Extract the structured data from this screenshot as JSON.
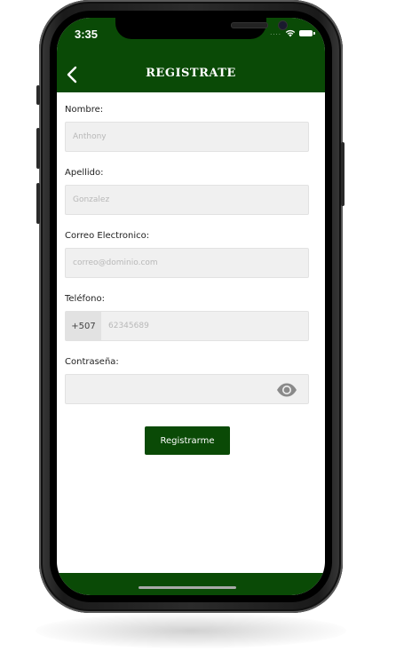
{
  "status_bar": {
    "time": "3:35",
    "signal": "...."
  },
  "header": {
    "title": "REGISTRATE"
  },
  "form": {
    "nombre": {
      "label": "Nombre:",
      "placeholder": "Anthony"
    },
    "apellido": {
      "label": "Apellido:",
      "placeholder": "Gonzalez"
    },
    "correo": {
      "label": "Correo Electronico:",
      "placeholder": "correo@dominio.com"
    },
    "telefono": {
      "label": "Teléfono:",
      "prefix": "+507",
      "placeholder": "62345689"
    },
    "contrasena": {
      "label": "Contraseña:",
      "placeholder": ""
    },
    "submit_label": "Registrarme"
  },
  "icons": {
    "back": "chevron-left-icon",
    "wifi": "wifi-icon",
    "battery": "battery-icon",
    "password_toggle": "eye-icon"
  },
  "colors": {
    "brand": "#0a4a06",
    "field_bg": "#f0f0f0",
    "prefix_bg": "#e2e2e2"
  }
}
